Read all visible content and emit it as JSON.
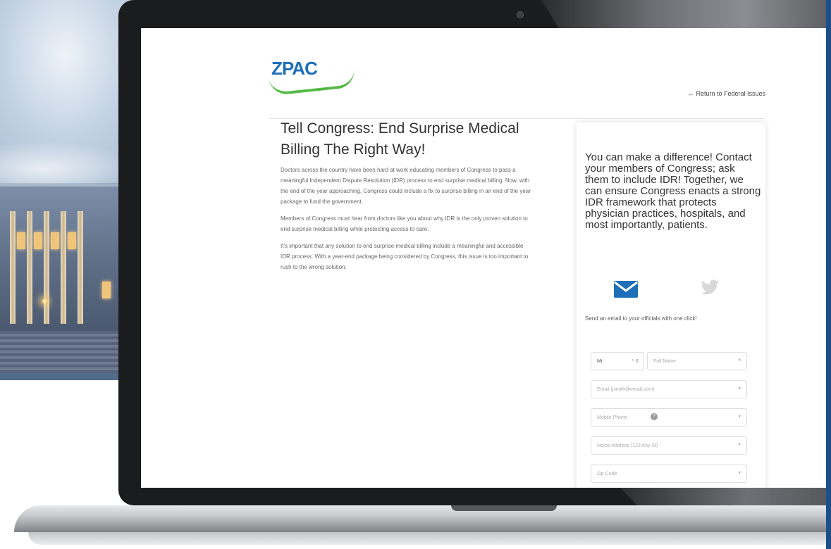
{
  "site": {
    "logo_text": "ZPAC",
    "return_link": "←  Return to Federal Issues"
  },
  "article": {
    "title": "Tell Congress: End Surprise Medical Billing The Right Way!",
    "paragraphs": [
      "Doctors across the country have been hard at work educating members of Congress to pass a meaningful Independent Dispute Resolution (IDR) process to end surprise medical billing. Now, with the end of the year approaching, Congress could include a fix to surprise billing in an end of the year package to fund the government.",
      "Members of Congress must hear from doctors like you about why IDR is the only proven solution to end surprise medical billing while protecting access to care.",
      "It's important that any solution to end surprise medical billing include a meaningful and accessible IDR process. With a year-end package being considered by Congress, this issue is too important to rush to the wrong solution."
    ]
  },
  "panel": {
    "heading": "You can make a difference! Contact your members of Congress; ask them to include IDR! Together, we can ensure Congress enacts a strong IDR framework that protects physician practices, hospitals, and most importantly, patients.",
    "subtext": "Send an email to your officials with one click!",
    "salutation_value": "Mr.",
    "salutation_required": "*",
    "fields": {
      "full_name": "Full Name",
      "email": "Email (jsmith@email.com)",
      "mobile": "Mobile Phone",
      "address": "Home Address (123 Any St)",
      "zip": "Zip Code"
    },
    "required_mark": "*"
  },
  "colors": {
    "logo_blue": "#1d6fb8",
    "logo_green": "#56b947",
    "email_icon": "#1d6fb8",
    "twitter_icon": "#d8d8d8"
  }
}
